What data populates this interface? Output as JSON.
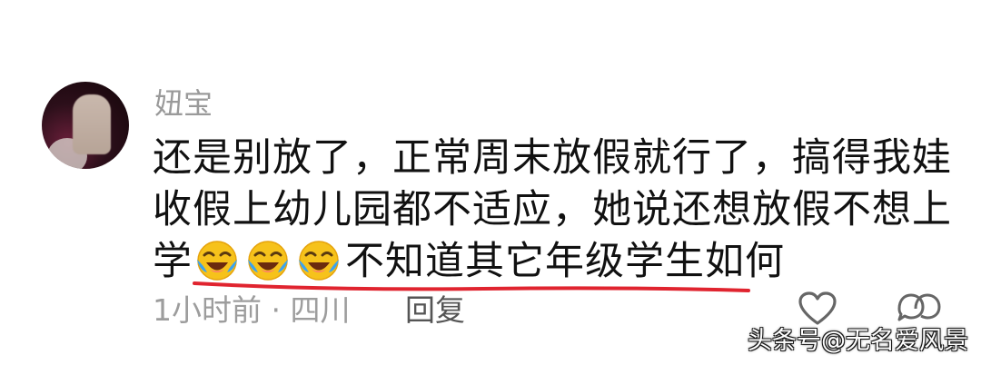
{
  "comment": {
    "username": "妞宝",
    "lines": [
      "还是别放了，正常周末放假就行了，搞得我娃",
      "收假上幼儿园都不适应，她说还想放假不想上",
      "学"
    ],
    "line3_suffix": "不知道其它年级学生如何",
    "emojis": [
      "laughing-crying-emoji",
      "laughing-crying-emoji",
      "laughing-crying-emoji"
    ],
    "meta": "1小时前 · 四川",
    "reply_label": "回复"
  },
  "icons": {
    "like": "heart-outline-icon",
    "comments": "comment-bubbles-icon"
  },
  "watermark": "头条号@无名爱风景",
  "colors": {
    "underline": "#e0242f",
    "username": "#9a9a9a",
    "text": "#111111",
    "meta": "#9d9d9d",
    "emoji_face": "#f6c21b",
    "emoji_tears": "#3aa3f1"
  }
}
